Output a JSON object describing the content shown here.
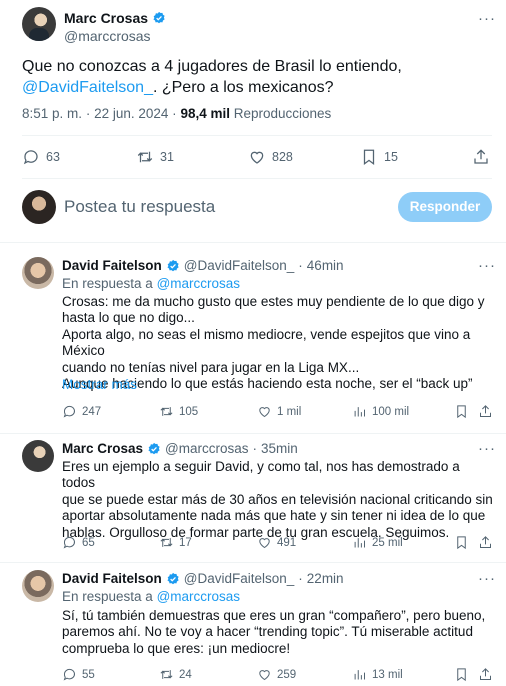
{
  "main_tweet": {
    "author_name": "Marc Crosas",
    "author_handle": "@marccrosas",
    "text_part1": "Que no conozcas a 4 jugadores de Brasil lo entiendo, ",
    "text_mention": "@DavidFaitelson_",
    "text_part2": ". ¿Pero a los mexicanos?",
    "time": "8:51 p. m.",
    "separator": "·",
    "date": "22 jun. 2024",
    "views_count": "98,4 mil",
    "views_label": "Reproducciones",
    "stats": {
      "replies": "63",
      "retweets": "31",
      "likes": "828",
      "bookmarks": "15"
    }
  },
  "composer": {
    "placeholder": "Postea tu respuesta",
    "reply_button": "Responder"
  },
  "replies": [
    {
      "author_name": "David Faitelson",
      "author_handle": "@DavidFaitelson_",
      "separator": "·",
      "time": "46min",
      "in_reply_prefix": "En respuesta a",
      "in_reply_handle": "@marccrosas",
      "lines": [
        "Crosas: me da mucho gusto que estes muy pendiente de lo que digo y",
        "hasta lo que no digo...",
        "Aporta algo, no seas el mismo mediocre, vende espejitos que vino a México",
        "cuando no tenías nivel para jugar en la Liga MX...",
        "Aunque haciendo lo que estás haciendo esta noche, ser el “back up”"
      ],
      "show_more": "Mostrar más",
      "stats": {
        "replies": "247",
        "retweets": "105",
        "likes": "1 mil",
        "views": "100 mil"
      }
    },
    {
      "author_name": "Marc Crosas",
      "author_handle": "@marccrosas",
      "separator": "·",
      "time": "35min",
      "lines": [
        "Eres un ejemplo a seguir David, y como tal, nos has demostrado a todos",
        "que se puede estar más de 30 años en televisión nacional criticando sin",
        "aportar absolutamente nada más que hate y sin tener ni idea de lo que",
        "hablas. Orgulloso de formar parte de tu gran escuela. Seguimos."
      ],
      "stats": {
        "replies": "65",
        "retweets": "17",
        "likes": "491",
        "views": "25 mil"
      }
    },
    {
      "author_name": "David Faitelson",
      "author_handle": "@DavidFaitelson_",
      "separator": "·",
      "time": "22min",
      "in_reply_prefix": "En respuesta a",
      "in_reply_handle": "@marccrosas",
      "lines": [
        "Sí, tú también demuestras que eres un gran “compañero”, pero bueno,",
        "paremos ahí. No te voy a hacer “trending topic”. Tú miserable actitud",
        "comprueba lo que eres: ¡un mediocre!"
      ],
      "stats": {
        "replies": "55",
        "retweets": "24",
        "likes": "259",
        "views": "13 mil"
      }
    }
  ],
  "more_glyph": "···",
  "colors": {
    "accent": "#1d9bf0",
    "muted": "#536471",
    "text": "#0f1419",
    "divider": "#eff3f4",
    "button_disabled": "#8ecdf8"
  }
}
